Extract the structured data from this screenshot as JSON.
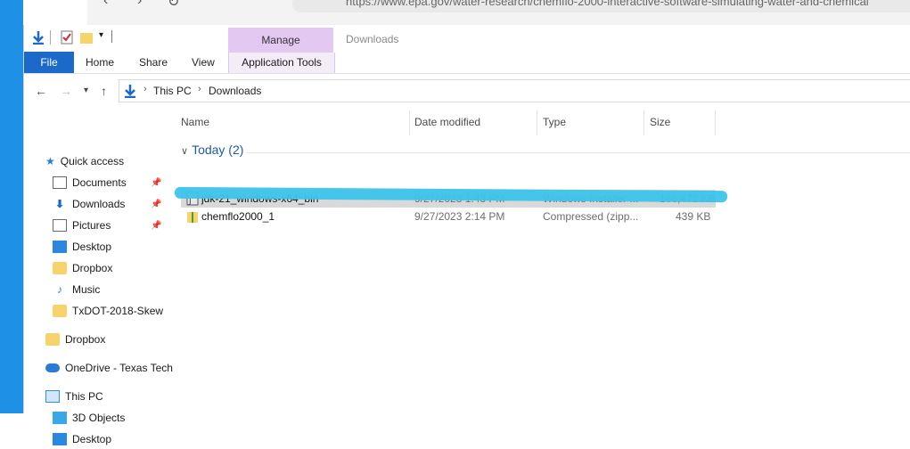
{
  "browser": {
    "url": "https://www.epa.gov/water-research/chemflo-2000-interactive-software-simulating-water-and-chemical"
  },
  "window": {
    "title": "Downloads",
    "contextual_tab_group": "Manage",
    "contextual_tab": "Application Tools"
  },
  "ribbon": {
    "file": "File",
    "home": "Home",
    "share": "Share",
    "view": "View"
  },
  "address": {
    "crumbs": [
      "This PC",
      "Downloads"
    ]
  },
  "nav": {
    "quick_access": "Quick access",
    "items": [
      {
        "label": "Documents",
        "pinned": true
      },
      {
        "label": "Downloads",
        "pinned": true
      },
      {
        "label": "Pictures",
        "pinned": true
      },
      {
        "label": "Desktop",
        "pinned": false
      },
      {
        "label": "Dropbox",
        "pinned": false
      },
      {
        "label": "Music",
        "pinned": false
      },
      {
        "label": "TxDOT-2018-Skew",
        "pinned": false
      }
    ],
    "dropbox": "Dropbox",
    "onedrive": "OneDrive - Texas Tech",
    "this_pc": "This PC",
    "objects3d": "3D Objects",
    "desktop2": "Desktop"
  },
  "columns": {
    "name": "Name",
    "date": "Date modified",
    "type": "Type",
    "size": "Size"
  },
  "group": {
    "label": "Today (2)"
  },
  "files": [
    {
      "name": "jdk-21_windows-x64_bin",
      "date": "9/27/2023 1:43 PM",
      "type": "Windows Installer ...",
      "size": "166,472 KB"
    },
    {
      "name": "chemflo2000_1",
      "date": "9/27/2023 2:14 PM",
      "type": "Compressed (zipp...",
      "size": "439 KB"
    }
  ],
  "colors": {
    "file_tab": "#1b6ac9",
    "manage_tab": "#e3c8f2",
    "selection": "#d9d9d9",
    "annotation": "#3cc4ea"
  }
}
